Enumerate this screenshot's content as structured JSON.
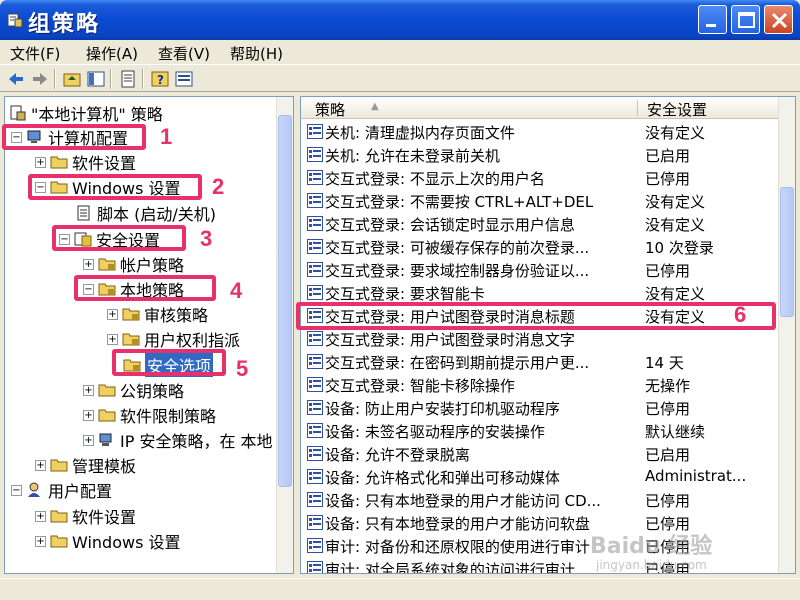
{
  "window": {
    "title": "组策略"
  },
  "menu": [
    "文件(F)",
    "操作(A)",
    "查看(V)",
    "帮助(H)"
  ],
  "tree": {
    "root": "\"本地计算机\" 策略",
    "items": [
      {
        "label": "计算机配置"
      },
      {
        "label": "软件设置"
      },
      {
        "label": "Windows 设置"
      },
      {
        "label": "脚本 (启动/关机)"
      },
      {
        "label": "安全设置"
      },
      {
        "label": "帐户策略"
      },
      {
        "label": "本地策略"
      },
      {
        "label": "审核策略"
      },
      {
        "label": "用户权利指派"
      },
      {
        "label": "安全选项"
      },
      {
        "label": "公钥策略"
      },
      {
        "label": "软件限制策略"
      },
      {
        "label": "IP 安全策略，在 本地"
      },
      {
        "label": "管理模板"
      },
      {
        "label": "用户配置"
      },
      {
        "label": "软件设置"
      },
      {
        "label": "Windows 设置"
      }
    ]
  },
  "list": {
    "columns": [
      "策略",
      "安全设置"
    ],
    "rows": [
      {
        "policy": "关机: 清理虚拟内存页面文件",
        "setting": "没有定义"
      },
      {
        "policy": "关机: 允许在未登录前关机",
        "setting": "已启用"
      },
      {
        "policy": "交互式登录: 不显示上次的用户名",
        "setting": "已停用"
      },
      {
        "policy": "交互式登录: 不需要按 CTRL+ALT+DEL",
        "setting": "没有定义"
      },
      {
        "policy": "交互式登录: 会话锁定时显示用户信息",
        "setting": "没有定义"
      },
      {
        "policy": "交互式登录: 可被缓存保存的前次登录...",
        "setting": "10 次登录"
      },
      {
        "policy": "交互式登录: 要求域控制器身份验证以...",
        "setting": "已停用"
      },
      {
        "policy": "交互式登录: 要求智能卡",
        "setting": "没有定义"
      },
      {
        "policy": "交互式登录: 用户试图登录时消息标题",
        "setting": "没有定义"
      },
      {
        "policy": "交互式登录: 用户试图登录时消息文字",
        "setting": ""
      },
      {
        "policy": "交互式登录: 在密码到期前提示用户更...",
        "setting": "14 天"
      },
      {
        "policy": "交互式登录: 智能卡移除操作",
        "setting": "无操作"
      },
      {
        "policy": "设备: 防止用户安装打印机驱动程序",
        "setting": "已停用"
      },
      {
        "policy": "设备: 未签名驱动程序的安装操作",
        "setting": "默认继续"
      },
      {
        "policy": "设备: 允许不登录脱离",
        "setting": "已启用"
      },
      {
        "policy": "设备: 允许格式化和弹出可移动媒体",
        "setting": "Administrat..."
      },
      {
        "policy": "设备: 只有本地登录的用户才能访问 CD...",
        "setting": "已停用"
      },
      {
        "policy": "设备: 只有本地登录的用户才能访问软盘",
        "setting": "已停用"
      },
      {
        "policy": "审计: 对备份和还原权限的使用进行审计",
        "setting": "已停用"
      },
      {
        "policy": "审计: 对全局系统对象的访问进行审计",
        "setting": "已停用"
      }
    ]
  },
  "annotations": [
    "1",
    "2",
    "3",
    "4",
    "5",
    "6"
  ],
  "watermark": {
    "main": "Baidu 经验",
    "sub": "jingyan.baidu.com"
  },
  "colors": {
    "titlebar": "#0a4bd3",
    "annotation": "#e8306a",
    "selection": "#316ac5"
  }
}
